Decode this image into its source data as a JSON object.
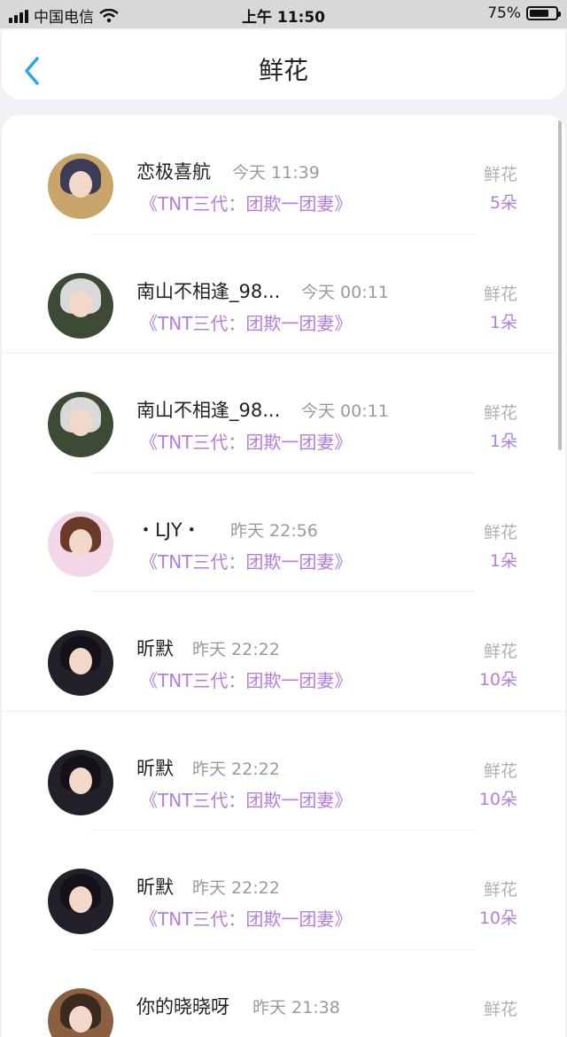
{
  "status_bar": {
    "carrier": "中国电信",
    "time": "上午 11:50",
    "battery": "75%",
    "battery_level": 0.75
  },
  "nav": {
    "title": "鲜花",
    "back_icon": "chevron-left-icon"
  },
  "colors": {
    "accent_purple": "#b57edc",
    "back_blue": "#2aa6f0"
  },
  "items": [
    {
      "name": "恋极喜航",
      "time": "今天 11:39",
      "book": "《TNT三代：团欺一团妻》",
      "gift_label": "鲜花",
      "count": "5朵",
      "avatar_color": "#c9a56a",
      "hair": "#3c3c58"
    },
    {
      "name": "南山不相逢_98...",
      "time": "今天 00:11",
      "book": "《TNT三代：团欺一团妻》",
      "gift_label": "鲜花",
      "count": "1朵",
      "avatar_color": "#3d4a36",
      "hair": "#d9d9d9"
    },
    {
      "name": "南山不相逢_98...",
      "time": "今天 00:11",
      "book": "《TNT三代：团欺一团妻》",
      "gift_label": "鲜花",
      "count": "1朵",
      "avatar_color": "#3d4a36",
      "hair": "#d9d9d9"
    },
    {
      "name": "・LJY・",
      "time": "昨天 22:56",
      "book": "《TNT三代：团欺一团妻》",
      "gift_label": "鲜花",
      "count": "1朵",
      "avatar_color": "#f1d7e8",
      "hair": "#6b3b2a"
    },
    {
      "name": "昕默",
      "time": "昨天 22:22",
      "book": "《TNT三代：团欺一团妻》",
      "gift_label": "鲜花",
      "count": "10朵",
      "avatar_color": "#222028",
      "hair": "#141218"
    },
    {
      "name": "昕默",
      "time": "昨天 22:22",
      "book": "《TNT三代：团欺一团妻》",
      "gift_label": "鲜花",
      "count": "10朵",
      "avatar_color": "#222028",
      "hair": "#141218"
    },
    {
      "name": "昕默",
      "time": "昨天 22:22",
      "book": "《TNT三代：团欺一团妻》",
      "gift_label": "鲜花",
      "count": "10朵",
      "avatar_color": "#222028",
      "hair": "#141218"
    },
    {
      "name": "你的晓晓呀",
      "time": "昨天 21:38",
      "book": "",
      "gift_label": "鲜花",
      "count": "",
      "avatar_color": "#8a6040",
      "hair": "#3a2a20"
    }
  ]
}
